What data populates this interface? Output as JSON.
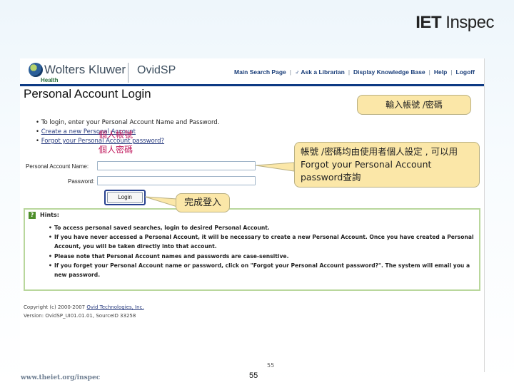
{
  "header": {
    "logo_brand": "IET",
    "logo_product": "Inspec"
  },
  "screenshot": {
    "brand": "Wolters Kluwer",
    "brand_sub": "Health",
    "product": "OvidSP",
    "nav": [
      "Main Search Page",
      "Ask a Librarian",
      "Display Knowledge Base",
      "Help",
      "Logoff"
    ],
    "page_title": "Personal Account Login",
    "bullets": [
      "To login, enter your Personal Account Name and Password.",
      "Create a new Personal Account",
      "Forgot your Personal Account password?"
    ],
    "account_name_label": "Personal Account Name:",
    "password_label": "Password:",
    "login_button": "Login",
    "hints_title": "Hints:",
    "hints": [
      "To access personal saved searches, login to desired Personal Account.",
      "If you have never accessed a Personal Account, it will be necessary to create a new Personal Account. Once you have created a Personal Account, you will be taken directly into that account.",
      "Please note that Personal Account names and passwords are case-sensitive.",
      "If you forget your Personal Account name or password, click on \"Forgot your Personal Account password?\". The system will email you a new password."
    ],
    "copyright_prefix": "Copyright (c) 2000-2007",
    "copyright_link": "Ovid Technologies, Inc.",
    "version": "Version: OvidSP_UI01.01.01, SourceID 33258",
    "page_number": "55"
  },
  "annotations": {
    "callout_login": "輸入帳號 /密碼",
    "callout_info": "帳號 /密碼均由使用者個人設定 , 可以用 Forgot your Personal Account password查詢",
    "callout_done": "完成登入",
    "red_account": "個人帳號",
    "red_password": "個人密碼"
  },
  "footer": {
    "url": "www.theiet.org/inspec",
    "page_number": "55"
  },
  "colors": {
    "nav_bar": "#0d3a84",
    "callout_fill": "#fbe7a8",
    "annotation_red": "#c0195d",
    "hints_border": "#b9d79c"
  }
}
